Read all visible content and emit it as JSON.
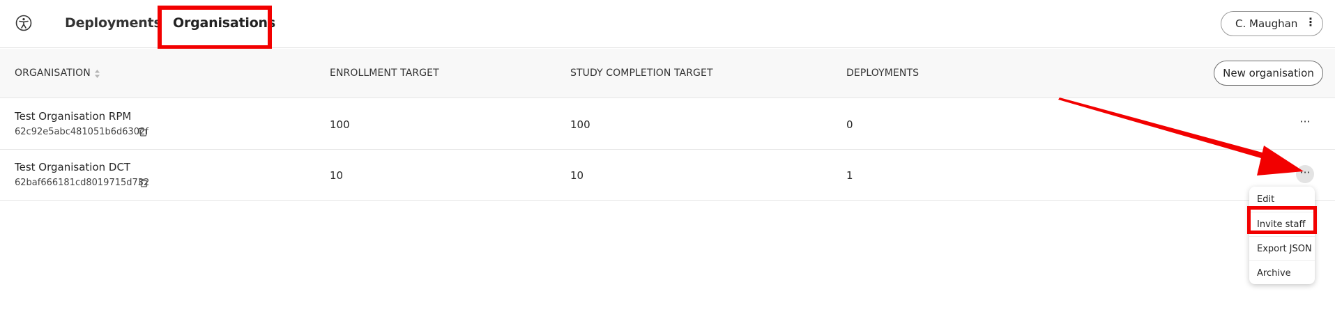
{
  "header": {
    "logo_icon": "accessibility-person-icon",
    "tabs": [
      {
        "label": "Deployments"
      },
      {
        "label": "Organisations"
      }
    ],
    "user_button": {
      "label": "C. Maughan",
      "menu_icon": "vertical-dots-icon"
    }
  },
  "table": {
    "columns": [
      "ORGANISATION",
      "ENROLLMENT TARGET",
      "STUDY COMPLETION TARGET",
      "DEPLOYMENTS"
    ],
    "new_button_label": "New organisation",
    "rows": [
      {
        "name": "Test Organisation RPM",
        "id": "62c92e5abc481051b6d6302f",
        "enrollment": "100",
        "completion": "100",
        "deployments": "0",
        "menu": "···"
      },
      {
        "name": "Test Organisation DCT",
        "id": "62baf666181cd8019715d732",
        "enrollment": "10",
        "completion": "10",
        "deployments": "1",
        "menu": "···"
      }
    ]
  },
  "row_menu": {
    "items": [
      "Edit",
      "Invite staff",
      "Export JSON",
      "Archive"
    ]
  },
  "annotation_color": "#f20000"
}
